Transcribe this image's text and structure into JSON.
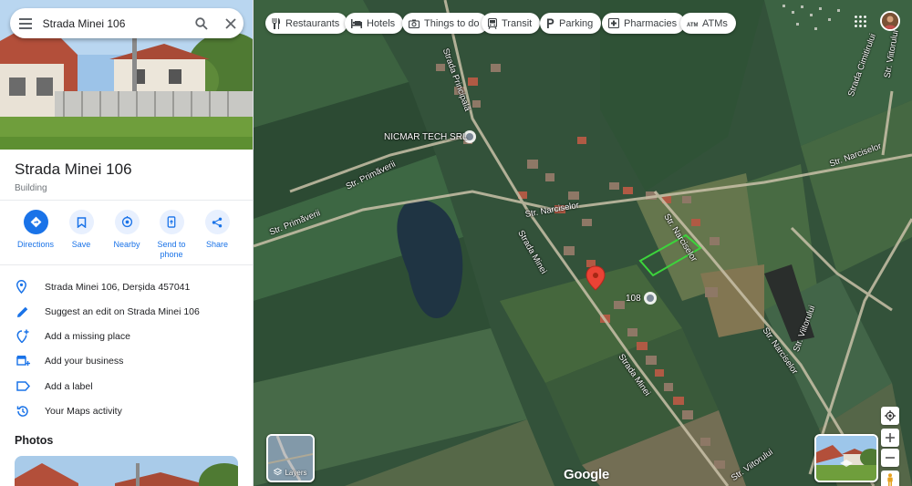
{
  "search": {
    "value": "Strada Minei 106",
    "menu_icon": "menu-icon",
    "search_icon": "search-icon",
    "close_icon": "close-icon"
  },
  "place": {
    "title": "Strada Minei 106",
    "type": "Building"
  },
  "actions": [
    {
      "label": "Directions",
      "icon": "directions-icon"
    },
    {
      "label": "Save",
      "icon": "bookmark-icon"
    },
    {
      "label": "Nearby",
      "icon": "nearby-icon"
    },
    {
      "label": "Send to phone",
      "icon": "send-to-phone-icon"
    },
    {
      "label": "Share",
      "icon": "share-icon"
    }
  ],
  "info_rows": [
    {
      "text": "Strada Minei 106, Derșida 457041",
      "icon": "location-pin-icon"
    },
    {
      "text": "Suggest an edit on Strada Minei 106",
      "icon": "edit-pencil-icon"
    },
    {
      "text": "Add a missing place",
      "icon": "add-place-icon"
    },
    {
      "text": "Add your business",
      "icon": "add-business-icon"
    },
    {
      "text": "Add a label",
      "icon": "label-icon"
    },
    {
      "text": "Your Maps activity",
      "icon": "history-icon"
    }
  ],
  "photos_title": "Photos",
  "map": {
    "chips": [
      {
        "label": "Restaurants",
        "icon": "restaurant-icon"
      },
      {
        "label": "Hotels",
        "icon": "hotel-icon"
      },
      {
        "label": "Things to do",
        "icon": "camera-icon"
      },
      {
        "label": "Transit",
        "icon": "transit-icon"
      },
      {
        "label": "Parking",
        "icon": "parking-icon"
      },
      {
        "label": "Pharmacies",
        "icon": "pharmacy-icon"
      },
      {
        "label": "ATMs",
        "icon": "atm-icon"
      }
    ],
    "poi_label": "NICMAR TECH SRL",
    "house_number": "108",
    "street_labels": [
      "Strada Principală",
      "Str. Primăverii",
      "Str. Primăverii",
      "Str. Narciselor",
      "Str. Narciselor",
      "Str. Narciselor",
      "Strada Minei",
      "Strada Minei",
      "Str. Narciselor",
      "Strada Cimitirului",
      "Str. Viitorului",
      "Str. Viitorului",
      "Str. Viitorului"
    ],
    "layers_label": "Layers",
    "logo": "Google",
    "colors": {
      "pin": "#ea4335",
      "parcel_outline": "#3cd43c",
      "accent": "#1a73e8"
    }
  }
}
